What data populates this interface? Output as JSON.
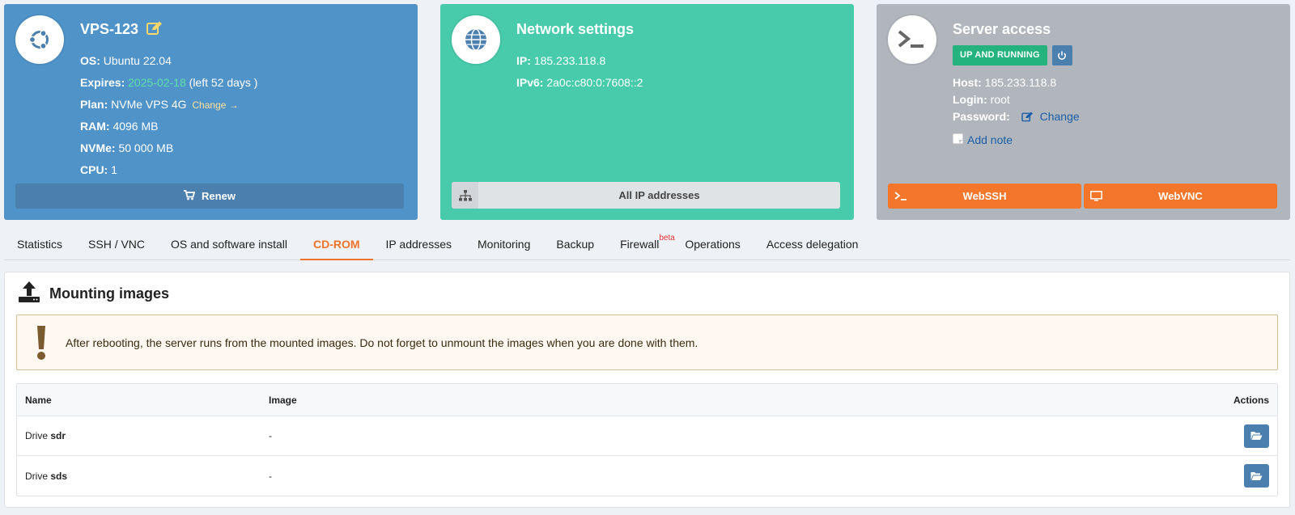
{
  "vps": {
    "title": "VPS-123",
    "os_label": "OS:",
    "os_value": "Ubuntu 22.04",
    "expires_label": "Expires:",
    "expires_date": "2025-02-18",
    "expires_left": "(left 52 days )",
    "plan_label": "Plan:",
    "plan_value": "NVMe VPS 4G",
    "plan_change": "Change",
    "ram_label": "RAM:",
    "ram_value": "4096 MB",
    "nvme_label": "NVMe:",
    "nvme_value": "50 000 MB",
    "cpu_label": "CPU:",
    "cpu_value": "1",
    "renew_label": "Renew",
    "color": "#5093c8"
  },
  "network": {
    "title": "Network settings",
    "ip_label": "IP:",
    "ip_value": "185.233.118.8",
    "ipv6_label": "IPv6:",
    "ipv6_value": "2a0c:c80:0:7608::2",
    "all_ips_label": "All IP addresses",
    "color": "#48cbab"
  },
  "access": {
    "title": "Server access",
    "status": "UP AND RUNNING",
    "host_label": "Host:",
    "host_value": "185.233.118.8",
    "login_label": "Login:",
    "login_value": "root",
    "password_label": "Password:",
    "password_change": "Change",
    "add_note": "Add note",
    "webssh_label": "WebSSH",
    "webvnc_label": "WebVNC",
    "color": "#b1b6bd"
  },
  "tabs": [
    {
      "label": "Statistics"
    },
    {
      "label": "SSH / VNC"
    },
    {
      "label": "OS and software install"
    },
    {
      "label": "CD-ROM",
      "active": true
    },
    {
      "label": "IP addresses"
    },
    {
      "label": "Monitoring"
    },
    {
      "label": "Backup"
    },
    {
      "label": "Firewall",
      "sup": "beta"
    },
    {
      "label": "Operations"
    },
    {
      "label": "Access delegation"
    }
  ],
  "panel": {
    "title": "Mounting images",
    "warning": "After rebooting, the server runs from the mounted images. Do not forget to unmount the images when you are done with them.",
    "columns": {
      "name": "Name",
      "image": "Image",
      "actions": "Actions"
    },
    "rows": [
      {
        "prefix": "Drive",
        "drive": "sdr",
        "image": "-"
      },
      {
        "prefix": "Drive",
        "drive": "sds",
        "image": "-"
      }
    ]
  },
  "icons": {
    "vps": "ubuntu-icon",
    "network": "globe-icon",
    "access": "terminal-icon"
  }
}
